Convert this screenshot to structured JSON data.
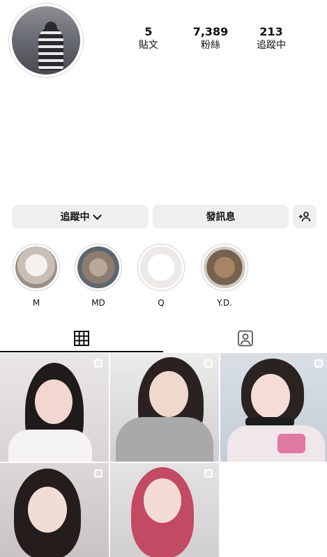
{
  "profile": {
    "stats": [
      {
        "value": "5",
        "label": "貼文"
      },
      {
        "value": "7,389",
        "label": "粉絲"
      },
      {
        "value": "213",
        "label": "追蹤中"
      }
    ]
  },
  "actions": {
    "following_label": "追蹤中",
    "message_label": "發訊息"
  },
  "icons": {
    "chevron": "chevron-down-icon",
    "add_person": "add-person-icon",
    "grid": "grid-icon",
    "tagged": "tagged-person-icon",
    "multi": "multi-select-icon"
  },
  "highlights": [
    {
      "name": "M"
    },
    {
      "name": "MD"
    },
    {
      "name": "Q"
    },
    {
      "name": "Y.D."
    }
  ],
  "posts_count": 5
}
